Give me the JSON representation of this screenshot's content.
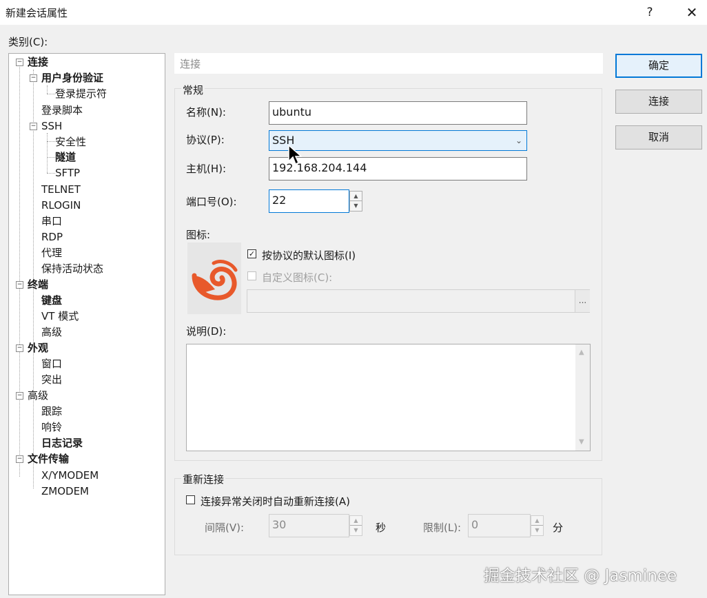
{
  "window": {
    "title": "新建会话属性",
    "help_glyph": "?",
    "close_glyph": "✕"
  },
  "category_label": "类别(C):",
  "tree": {
    "items": [
      {
        "label": "连接",
        "bold": true
      },
      {
        "label": "用户身份验证",
        "bold": true
      },
      {
        "label": "登录提示符",
        "bold": false
      },
      {
        "label": "登录脚本",
        "bold": false
      },
      {
        "label": "SSH",
        "bold": false
      },
      {
        "label": "安全性",
        "bold": false
      },
      {
        "label": "隧道",
        "bold": true
      },
      {
        "label": "SFTP",
        "bold": false
      },
      {
        "label": "TELNET",
        "bold": false
      },
      {
        "label": "RLOGIN",
        "bold": false
      },
      {
        "label": "串口",
        "bold": false
      },
      {
        "label": "RDP",
        "bold": false
      },
      {
        "label": "代理",
        "bold": false
      },
      {
        "label": "保持活动状态",
        "bold": false
      },
      {
        "label": "终端",
        "bold": true
      },
      {
        "label": "键盘",
        "bold": true
      },
      {
        "label": "VT 模式",
        "bold": false
      },
      {
        "label": "高级",
        "bold": false
      },
      {
        "label": "外观",
        "bold": true
      },
      {
        "label": "窗口",
        "bold": false
      },
      {
        "label": "突出",
        "bold": false
      },
      {
        "label": "高级",
        "bold": false
      },
      {
        "label": "跟踪",
        "bold": false
      },
      {
        "label": "响铃",
        "bold": false
      },
      {
        "label": "日志记录",
        "bold": true
      },
      {
        "label": "文件传输",
        "bold": true
      },
      {
        "label": "X/YMODEM",
        "bold": false
      },
      {
        "label": "ZMODEM",
        "bold": false
      }
    ]
  },
  "section_header": "连接",
  "general": {
    "title": "常规",
    "name_label": "名称(N):",
    "name_value": "ubuntu",
    "protocol_label": "协议(P):",
    "protocol_value": "SSH",
    "host_label": "主机(H):",
    "host_value": "192.168.204.144",
    "port_label": "端口号(O):",
    "port_value": "22",
    "icon_label": "图标:",
    "default_icon_label": "按协议的默认图标(I)",
    "default_icon_checked": true,
    "custom_icon_label": "自定义图标(C):",
    "custom_icon_checked": false,
    "browse_label": "...",
    "desc_label": "说明(D):",
    "desc_value": ""
  },
  "reconnect": {
    "title": "重新连接",
    "auto_label": "连接异常关闭时自动重新连接(A)",
    "auto_checked": false,
    "interval_label": "间隔(V):",
    "interval_value": "30",
    "interval_unit": "秒",
    "limit_label": "限制(L):",
    "limit_value": "0",
    "limit_unit": "分"
  },
  "buttons": {
    "ok": "确定",
    "connect": "连接",
    "cancel": "取消"
  },
  "watermark": "掘金技术社区 @ Jasminee",
  "colors": {
    "accent": "#0078d7",
    "icon_orange": "#e8592b"
  }
}
